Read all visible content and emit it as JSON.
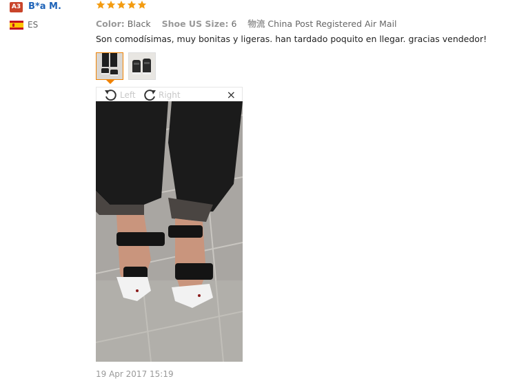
{
  "reviewer": {
    "badge": "A3",
    "name": "B*a M.",
    "country_code": "ES"
  },
  "rating": {
    "stars": 5,
    "max": 5,
    "color": "#f39c12"
  },
  "meta": {
    "color_label": "Color:",
    "color_value": "Black",
    "size_label": "Shoe US Size:",
    "size_value": "6",
    "shipping_label": "物流",
    "shipping_value": "China Post Registered Air Mail"
  },
  "review_text": "Son comodísimas, muy bonitas y ligeras. han tardado poquito en llegar. gracias vendedor!",
  "viewer": {
    "rotate_left": "Left",
    "rotate_right": "Right",
    "close": "×"
  },
  "date": "19 Apr 2017 15:19",
  "colors": {
    "accent": "#f08200",
    "name_link": "#1e63b8",
    "badge": "#c9442a"
  }
}
